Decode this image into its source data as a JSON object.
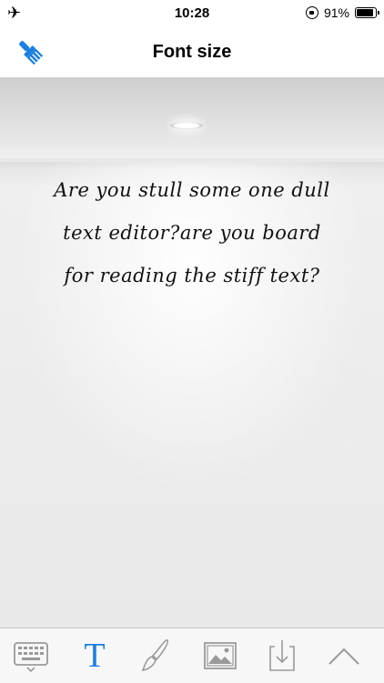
{
  "status_bar": {
    "time": "10:28",
    "battery_percent": "91%",
    "battery_level": 0.91
  },
  "nav": {
    "title": "Font size"
  },
  "editor": {
    "lines": [
      "Are you stull some one dull",
      "text editor?are you board",
      "for reading the stiff text?"
    ]
  },
  "toolbar": {
    "items": [
      {
        "name": "keyboard-icon",
        "active": false
      },
      {
        "name": "text-format-icon",
        "label": "T",
        "active": true
      },
      {
        "name": "brush-icon",
        "active": false
      },
      {
        "name": "image-icon",
        "active": false
      },
      {
        "name": "download-icon",
        "active": false
      },
      {
        "name": "chevron-up-icon",
        "active": false
      }
    ]
  },
  "colors": {
    "accent": "#1b7fe3",
    "icon_gray": "#9a9a9a"
  }
}
